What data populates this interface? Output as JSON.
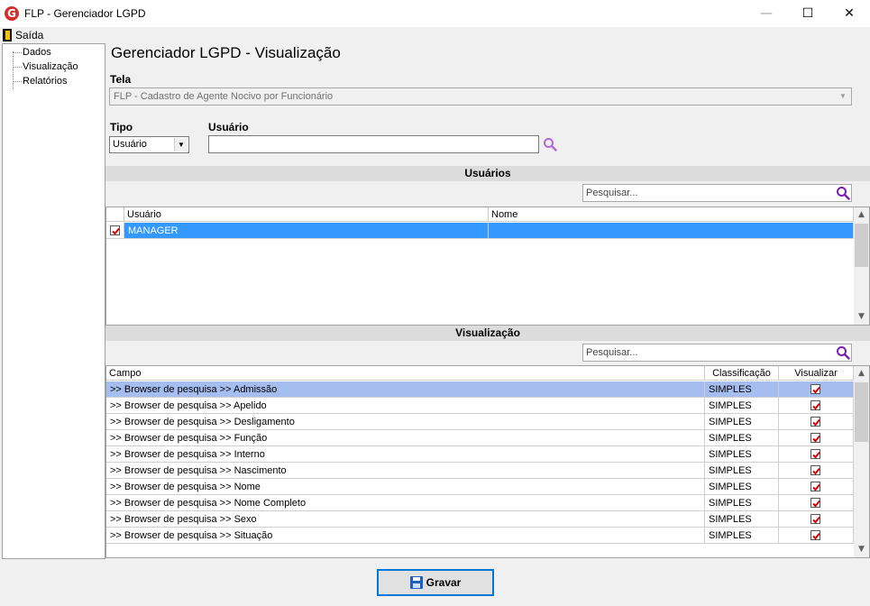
{
  "window": {
    "title": "FLP - Gerenciador LGPD",
    "logo_letter": "G",
    "min_glyph": "—",
    "max_glyph": "☐",
    "close_glyph": "✕"
  },
  "menu": {
    "exit_label": "Saída"
  },
  "sidebar": {
    "items": [
      {
        "label": "Dados"
      },
      {
        "label": "Visualização"
      },
      {
        "label": "Relatórios"
      }
    ]
  },
  "main": {
    "title": "Gerenciador LGPD - Visualização",
    "tela_label": "Tela",
    "tela_value": "FLP - Cadastro de Agente Nocivo por Funcionário",
    "tipo_label": "Tipo",
    "tipo_value": "Usuário",
    "usuario_label": "Usuário",
    "usuario_value": ""
  },
  "users_section": {
    "header": "Usuários",
    "search_placeholder": "Pesquisar...",
    "columns": [
      "Usuário",
      "Nome"
    ],
    "rows": [
      {
        "checked": true,
        "usuario": "MANAGER",
        "nome": ""
      }
    ]
  },
  "view_section": {
    "header": "Visualização",
    "search_placeholder": "Pesquisar...",
    "columns": [
      "Campo",
      "Classificação",
      "Visualizar"
    ],
    "rows": [
      {
        "campo": ">> Browser de pesquisa >> Admissão",
        "classificacao": "SIMPLES",
        "visualizar": true
      },
      {
        "campo": ">> Browser de pesquisa >> Apelido",
        "classificacao": "SIMPLES",
        "visualizar": true
      },
      {
        "campo": ">> Browser de pesquisa >> Desligamento",
        "classificacao": "SIMPLES",
        "visualizar": true
      },
      {
        "campo": ">> Browser de pesquisa >> Função",
        "classificacao": "SIMPLES",
        "visualizar": true
      },
      {
        "campo": ">> Browser de pesquisa >> Interno",
        "classificacao": "SIMPLES",
        "visualizar": true
      },
      {
        "campo": ">> Browser de pesquisa >> Nascimento",
        "classificacao": "SIMPLES",
        "visualizar": true
      },
      {
        "campo": ">> Browser de pesquisa >> Nome",
        "classificacao": "SIMPLES",
        "visualizar": true
      },
      {
        "campo": ">> Browser de pesquisa >> Nome Completo",
        "classificacao": "SIMPLES",
        "visualizar": true
      },
      {
        "campo": ">> Browser de pesquisa >> Sexo",
        "classificacao": "SIMPLES",
        "visualizar": true
      },
      {
        "campo": ">> Browser de pesquisa >> Situação",
        "classificacao": "SIMPLES",
        "visualizar": true
      }
    ]
  },
  "actions": {
    "save_label": "Gravar",
    "save_hotkey": "G"
  },
  "colors": {
    "selection": "#3399ff",
    "highlight": "#a6bdf0",
    "check": "#d40000",
    "accent": "#0078d7"
  }
}
